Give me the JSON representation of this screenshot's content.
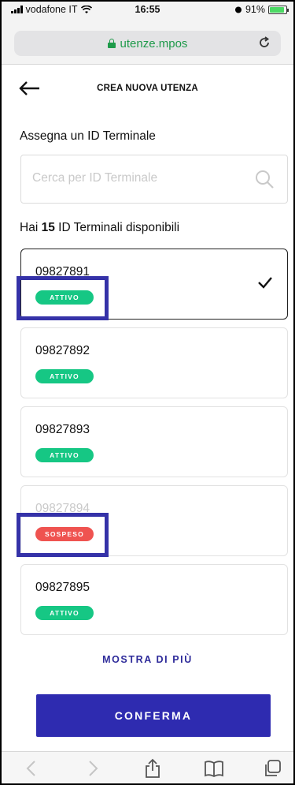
{
  "status_bar": {
    "carrier": "vodafone IT",
    "time": "16:55",
    "battery": "91%"
  },
  "browser": {
    "url": "utenze.mpos"
  },
  "header": {
    "title": "CREA NUOVA UTENZA"
  },
  "assign": {
    "title": "Assegna un ID Terminale",
    "search_placeholder": "Cerca per ID Terminale"
  },
  "availability": {
    "prefix": "Hai",
    "count": "15",
    "suffix": "ID Terminali disponibili"
  },
  "terminals": [
    {
      "id": "09827891",
      "status": "ATTIVO",
      "selected": true
    },
    {
      "id": "09827892",
      "status": "ATTIVO",
      "selected": false
    },
    {
      "id": "09827893",
      "status": "ATTIVO",
      "selected": false
    },
    {
      "id": "09827894",
      "status": "SOSPESO",
      "selected": false
    },
    {
      "id": "09827895",
      "status": "ATTIVO",
      "selected": false
    }
  ],
  "actions": {
    "show_more": "MOSTRA DI PIÙ",
    "confirm": "CONFERMA"
  },
  "colors": {
    "primary": "#2e2bb0",
    "active": "#16c784",
    "suspended": "#ef5350",
    "url_green": "#1e9a4a",
    "highlight": "#3532a8"
  }
}
